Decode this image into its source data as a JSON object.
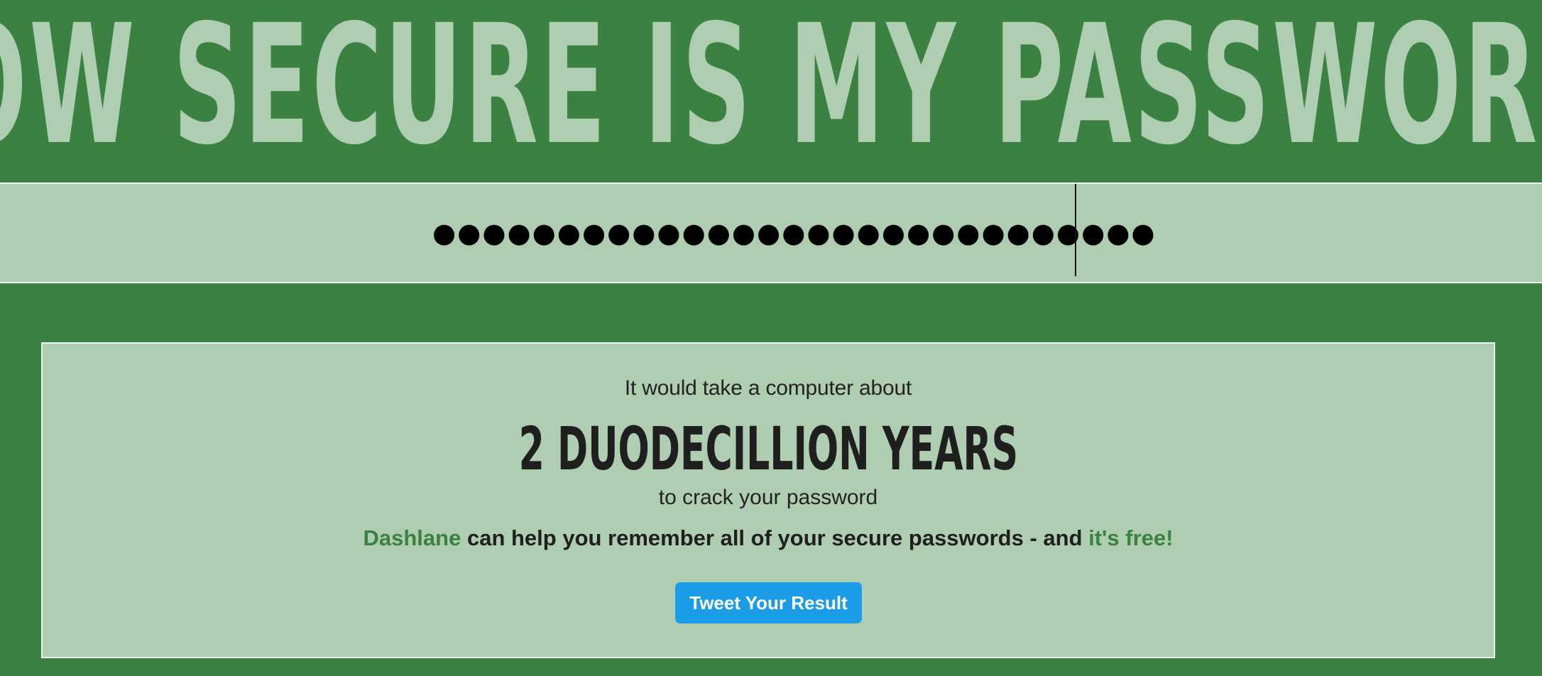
{
  "header": {
    "title": "HOW SECURE IS MY PASSWORD?"
  },
  "password_input": {
    "masked_value": "●●●●●●●●●●●●●●●●●●●●●●●●●●●●●"
  },
  "result": {
    "intro": "It would take a computer about",
    "time": "2 DUODECILLION YEARS",
    "outro": "to crack your password",
    "promo": {
      "brand": "Dashlane",
      "middle": " can help you remember all of your secure passwords - and ",
      "free": "it's free!"
    },
    "tweet_button_label": "Tweet Your Result"
  },
  "colors": {
    "background_green": "#3a8142",
    "panel_light_green": "#afcdb1",
    "link_green": "#3a8142",
    "tweet_blue": "#1b9ce6"
  }
}
